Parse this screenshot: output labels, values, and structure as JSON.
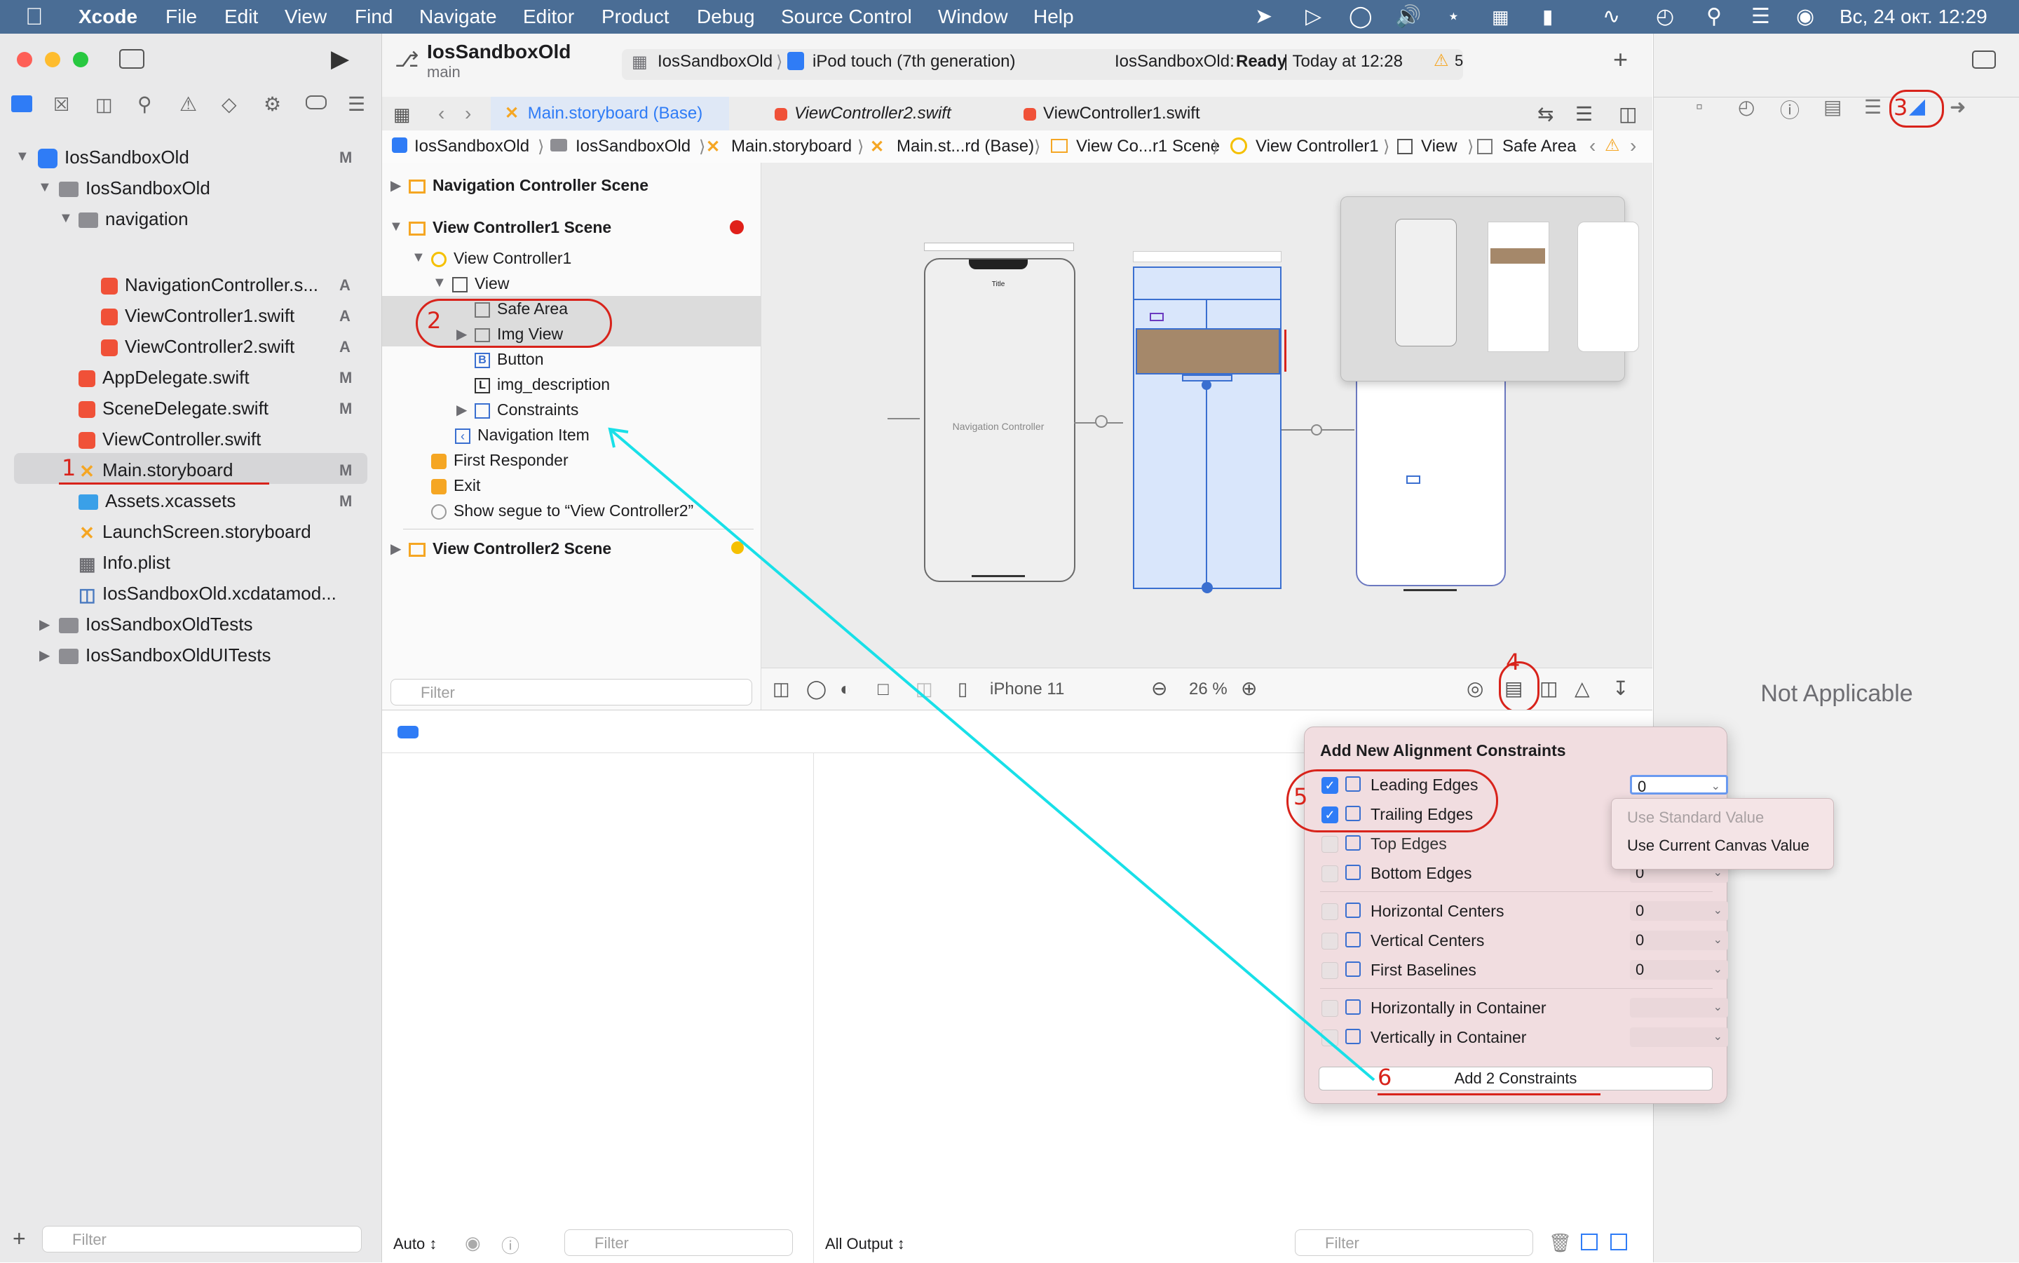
{
  "menubar": {
    "app": "Xcode",
    "items": [
      "File",
      "Edit",
      "View",
      "Find",
      "Navigate",
      "Editor",
      "Product",
      "Debug",
      "Source Control",
      "Window",
      "Help"
    ],
    "datetime": "Вс, 24 окт.  12:29"
  },
  "toolbar": {
    "project": "IosSandboxOld",
    "branch": "main",
    "scheme": "IosSandboxOld",
    "device": "iPod touch (7th generation)",
    "status_name": "IosSandboxOld:",
    "status_state": "Ready",
    "status_time": "| Today at 12:28",
    "warnings": "5"
  },
  "navigator": {
    "tree": [
      {
        "label": "IosSandboxOld",
        "badge": "M"
      },
      {
        "label": "IosSandboxOld",
        "badge": ""
      },
      {
        "label": "navigation",
        "badge": ""
      },
      {
        "label": "NavigationController.s...",
        "badge": "A"
      },
      {
        "label": "ViewController1.swift",
        "badge": "A"
      },
      {
        "label": "ViewController2.swift",
        "badge": "A"
      },
      {
        "label": "AppDelegate.swift",
        "badge": "M"
      },
      {
        "label": "SceneDelegate.swift",
        "badge": "M"
      },
      {
        "label": "ViewController.swift",
        "badge": ""
      },
      {
        "label": "Main.storyboard",
        "badge": "M"
      },
      {
        "label": "Assets.xcassets",
        "badge": "M"
      },
      {
        "label": "LaunchScreen.storyboard",
        "badge": ""
      },
      {
        "label": "Info.plist",
        "badge": ""
      },
      {
        "label": "IosSandboxOld.xcdatamod...",
        "badge": ""
      },
      {
        "label": "IosSandboxOldTests",
        "badge": ""
      },
      {
        "label": "IosSandboxOldUITests",
        "badge": ""
      }
    ],
    "filter_placeholder": "Filter"
  },
  "tabs": [
    "Main.storyboard (Base)",
    "ViewController2.swift",
    "ViewController1.swift"
  ],
  "jumpbar": [
    "IosSandboxOld",
    "IosSandboxOld",
    "Main.storyboard",
    "Main.st...rd (Base)",
    "View Co...r1 Scene",
    "View Controller1",
    "View",
    "Safe Area"
  ],
  "outline": {
    "rows": [
      {
        "label": "Navigation Controller Scene"
      },
      {
        "label": "View Controller1 Scene"
      },
      {
        "label": "View Controller1"
      },
      {
        "label": "View"
      },
      {
        "label": "Safe Area"
      },
      {
        "label": "Img View"
      },
      {
        "label": "Button"
      },
      {
        "label": "img_description"
      },
      {
        "label": "Constraints"
      },
      {
        "label": "Navigation Item"
      },
      {
        "label": "First Responder"
      },
      {
        "label": "Exit"
      },
      {
        "label": "Show segue to “View Controller2”"
      },
      {
        "label": "View Controller2 Scene"
      }
    ],
    "filter_placeholder": "Filter"
  },
  "canvas": {
    "nav_controller_label": "Navigation Controller",
    "nav_title": "Title",
    "device": "iPhone 11",
    "zoom": "26 %"
  },
  "inspector": {
    "message": "Not Applicable"
  },
  "popover": {
    "title": "Add New Alignment Constraints",
    "rows": [
      {
        "label": "Leading Edges",
        "value": "0",
        "checked": true
      },
      {
        "label": "Trailing Edges",
        "value": "",
        "checked": true
      },
      {
        "label": "Top Edges",
        "value": "",
        "checked": false
      },
      {
        "label": "Bottom Edges",
        "value": "0",
        "checked": false
      },
      {
        "label": "Horizontal Centers",
        "value": "0",
        "checked": false
      },
      {
        "label": "Vertical Centers",
        "value": "0",
        "checked": false
      },
      {
        "label": "First Baselines",
        "value": "0",
        "checked": false
      },
      {
        "label": "Horizontally in Container",
        "value": "",
        "checked": false
      },
      {
        "label": "Vertically in Container",
        "value": "",
        "checked": false
      }
    ],
    "button": "Add 2 Constraints",
    "menu": [
      "Use Standard Value",
      "Use Current Canvas Value"
    ]
  },
  "debug": {
    "auto": "Auto ↕",
    "output": "All Output ↕",
    "filter_placeholder": "Filter"
  },
  "annotations": [
    "1",
    "2",
    "3",
    "4",
    "5",
    "6"
  ],
  "colors": {
    "menubar": "#4a6d95",
    "accent": "#2f7cf6",
    "annotation": "#d8231b",
    "arrow": "#18e0e8",
    "popover": "#f1dde0"
  }
}
